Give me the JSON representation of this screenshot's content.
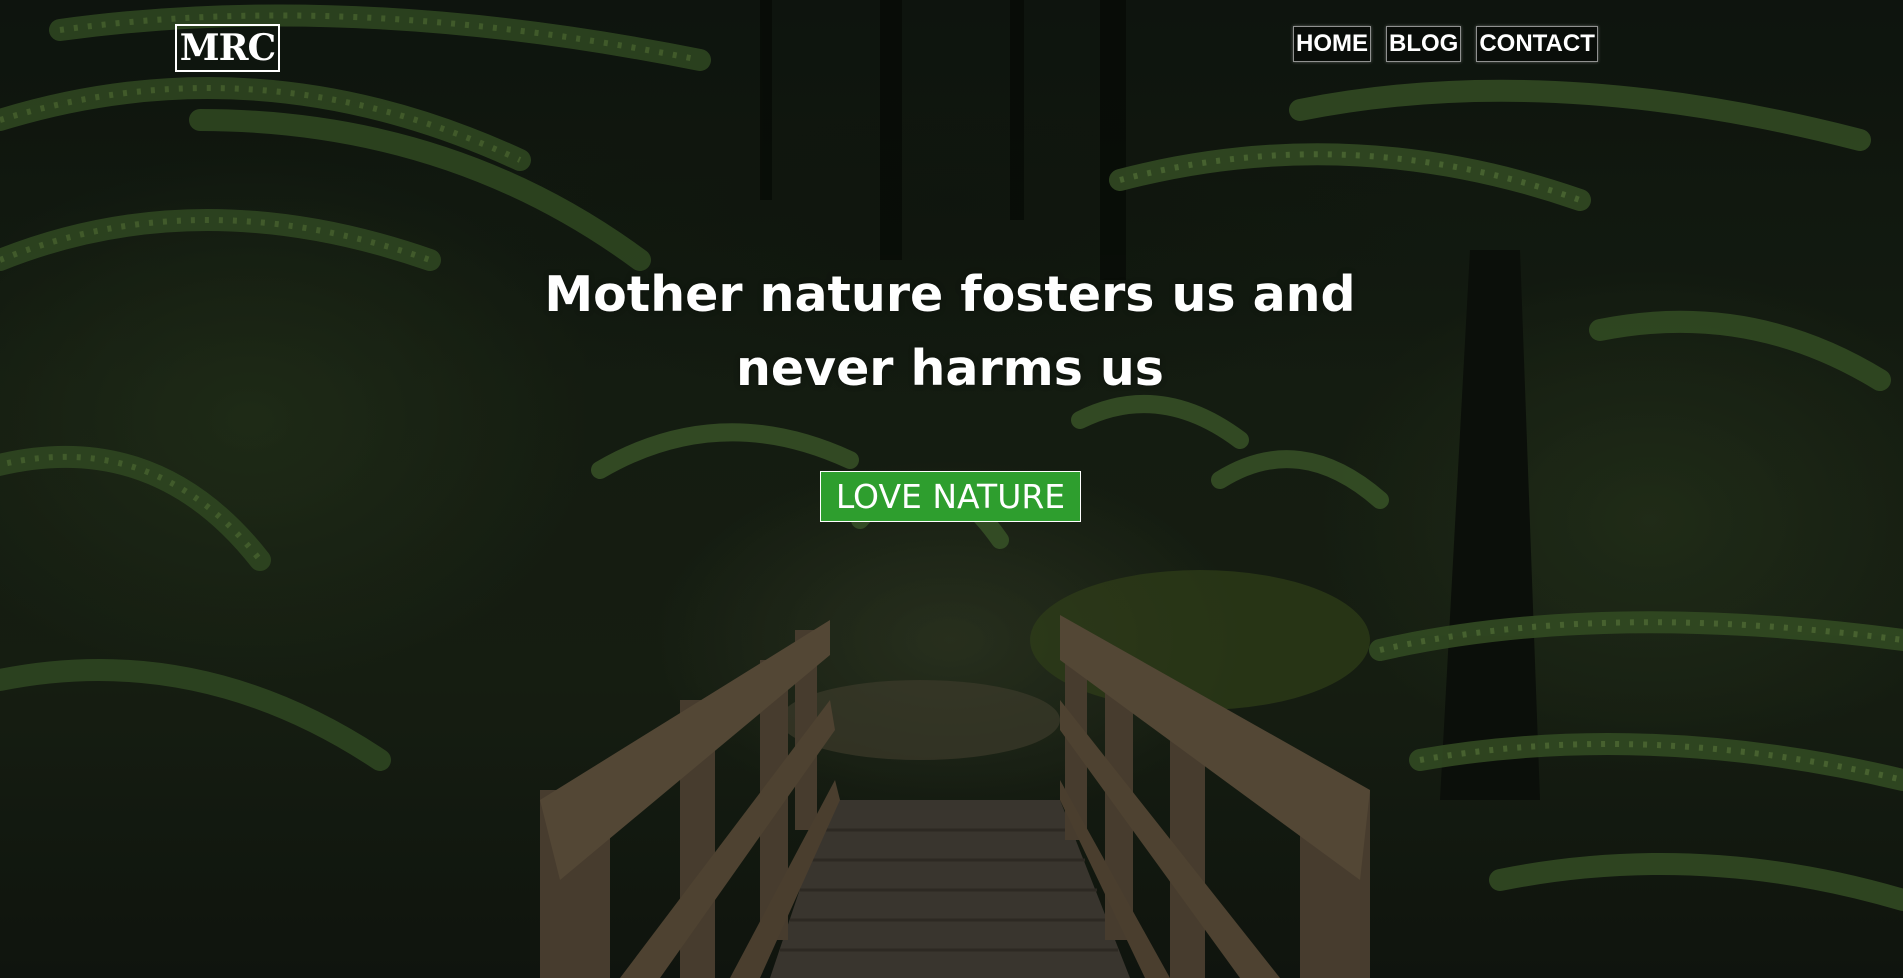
{
  "header": {
    "logo_text": "MRC",
    "nav": [
      {
        "label": "HOME"
      },
      {
        "label": "BLOG"
      },
      {
        "label": "CONTACT"
      }
    ]
  },
  "hero": {
    "headline_line1": "Mother nature fosters us and",
    "headline_line2": "never harms us",
    "cta_label": "LOVE NATURE",
    "background_image": "forest-path-wooden-bridge-ferns"
  },
  "colors": {
    "cta_background": "#2e9e2e",
    "text": "#ffffff",
    "foliage": "#2f4a22",
    "wood": "#5c4e3c"
  }
}
